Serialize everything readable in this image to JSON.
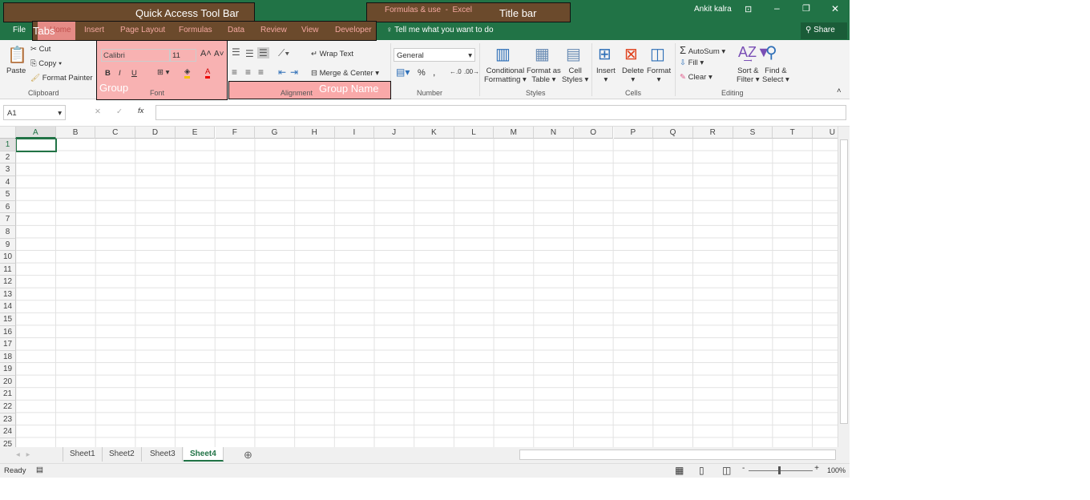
{
  "title_bar": {
    "document": "Formulas & use",
    "separator": "-",
    "app": "Excel",
    "user": "Ankit kalra",
    "icons": [
      "save-icon",
      "undo-icon",
      "redo-icon",
      "table-icon",
      "grid-icon",
      "customize-icon"
    ],
    "window_controls": [
      "ribbon-display-icon",
      "minimize-icon",
      "restore-icon",
      "close-icon"
    ]
  },
  "tabs": [
    "File",
    "Home",
    "Insert",
    "Page Layout",
    "Formulas",
    "Data",
    "Review",
    "View",
    "Developer"
  ],
  "active_tab": "Home",
  "tell_me": "Tell me what you want to do",
  "share": "Share",
  "ribbon": {
    "clipboard": {
      "name": "Clipboard",
      "paste": "Paste",
      "cut": "Cut",
      "copy": "Copy",
      "format_painter": "Format Painter"
    },
    "font": {
      "name": "Font",
      "font_name": "Calibri",
      "font_size": "11",
      "bold": "B",
      "italic": "I",
      "underline": "U",
      "font_color": "A"
    },
    "alignment": {
      "name": "Alignment",
      "wrap_text": "Wrap Text",
      "merge_center": "Merge & Center"
    },
    "number": {
      "name": "Number",
      "format": "General",
      "percent": "%",
      "comma": ","
    },
    "styles": {
      "name": "Styles",
      "conditional1": "Conditional",
      "conditional2": "Formatting",
      "format_table1": "Format as",
      "format_table2": "Table",
      "cell_styles1": "Cell",
      "cell_styles2": "Styles"
    },
    "cells": {
      "name": "Cells",
      "insert": "Insert",
      "delete": "Delete",
      "format": "Format"
    },
    "editing": {
      "name": "Editing",
      "autosum": "AutoSum",
      "fill": "Fill",
      "clear": "Clear",
      "sort1": "Sort &",
      "sort2": "Filter",
      "find1": "Find &",
      "find2": "Select"
    }
  },
  "formula_bar": {
    "name_box": "A1",
    "fx": "fx",
    "cancel": "✕",
    "enter": "✓",
    "value": ""
  },
  "columns": [
    "A",
    "B",
    "C",
    "D",
    "E",
    "F",
    "G",
    "H",
    "I",
    "J",
    "K",
    "L",
    "M",
    "N",
    "O",
    "P",
    "Q",
    "R",
    "S",
    "T",
    "U"
  ],
  "rows": [
    "1",
    "2",
    "3",
    "4",
    "5",
    "6",
    "7",
    "8",
    "9",
    "10",
    "11",
    "12",
    "13",
    "14",
    "15",
    "16",
    "17",
    "18",
    "19",
    "20",
    "21",
    "22",
    "23",
    "24",
    "25"
  ],
  "selected_cell": "A1",
  "sheets": [
    "Sheet1",
    "Sheet2",
    "Sheet3",
    "Sheet4"
  ],
  "active_sheet": "Sheet4",
  "status": {
    "ready": "Ready",
    "zoom": "100%"
  },
  "annotations": {
    "qat": "Quick Access Tool Bar",
    "title_bar": "Title bar",
    "tabs": "Tabs",
    "group": "Group",
    "group_name": "Group Name"
  },
  "colors": {
    "excel_green": "#217346",
    "annotation_brown": "#6b4a2c",
    "annotation_pink": "#f9a0a0"
  }
}
